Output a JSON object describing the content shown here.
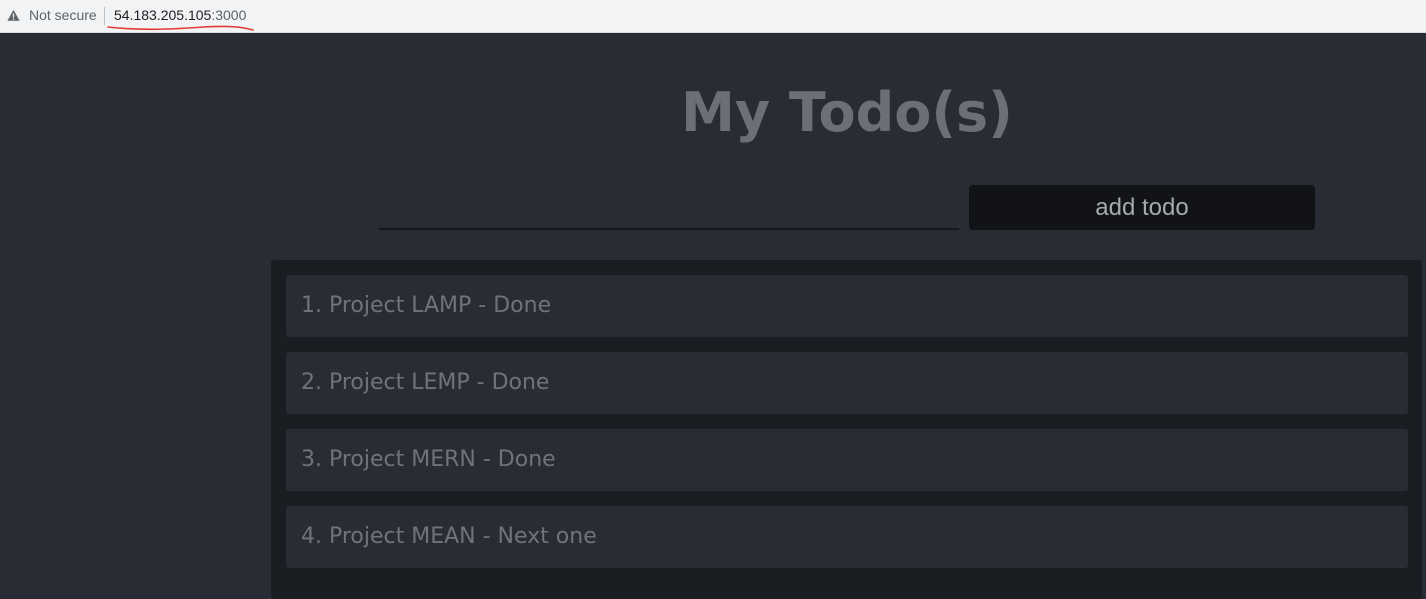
{
  "browser": {
    "security_label": "Not secure",
    "url_host": "54.183.205.105",
    "url_port": ":3000"
  },
  "app": {
    "title": "My Todo(s)",
    "input": {
      "value": "",
      "placeholder": ""
    },
    "add_button_label": "add todo",
    "todos": [
      "1. Project LAMP - Done",
      "2. Project LEMP - Done",
      "3. Project MERN - Done",
      "4. Project MEAN - Next one"
    ]
  },
  "colors": {
    "background": "#282c34",
    "list_panel": "#1a1d21",
    "button": "#111316",
    "annotation": "#e53935"
  }
}
